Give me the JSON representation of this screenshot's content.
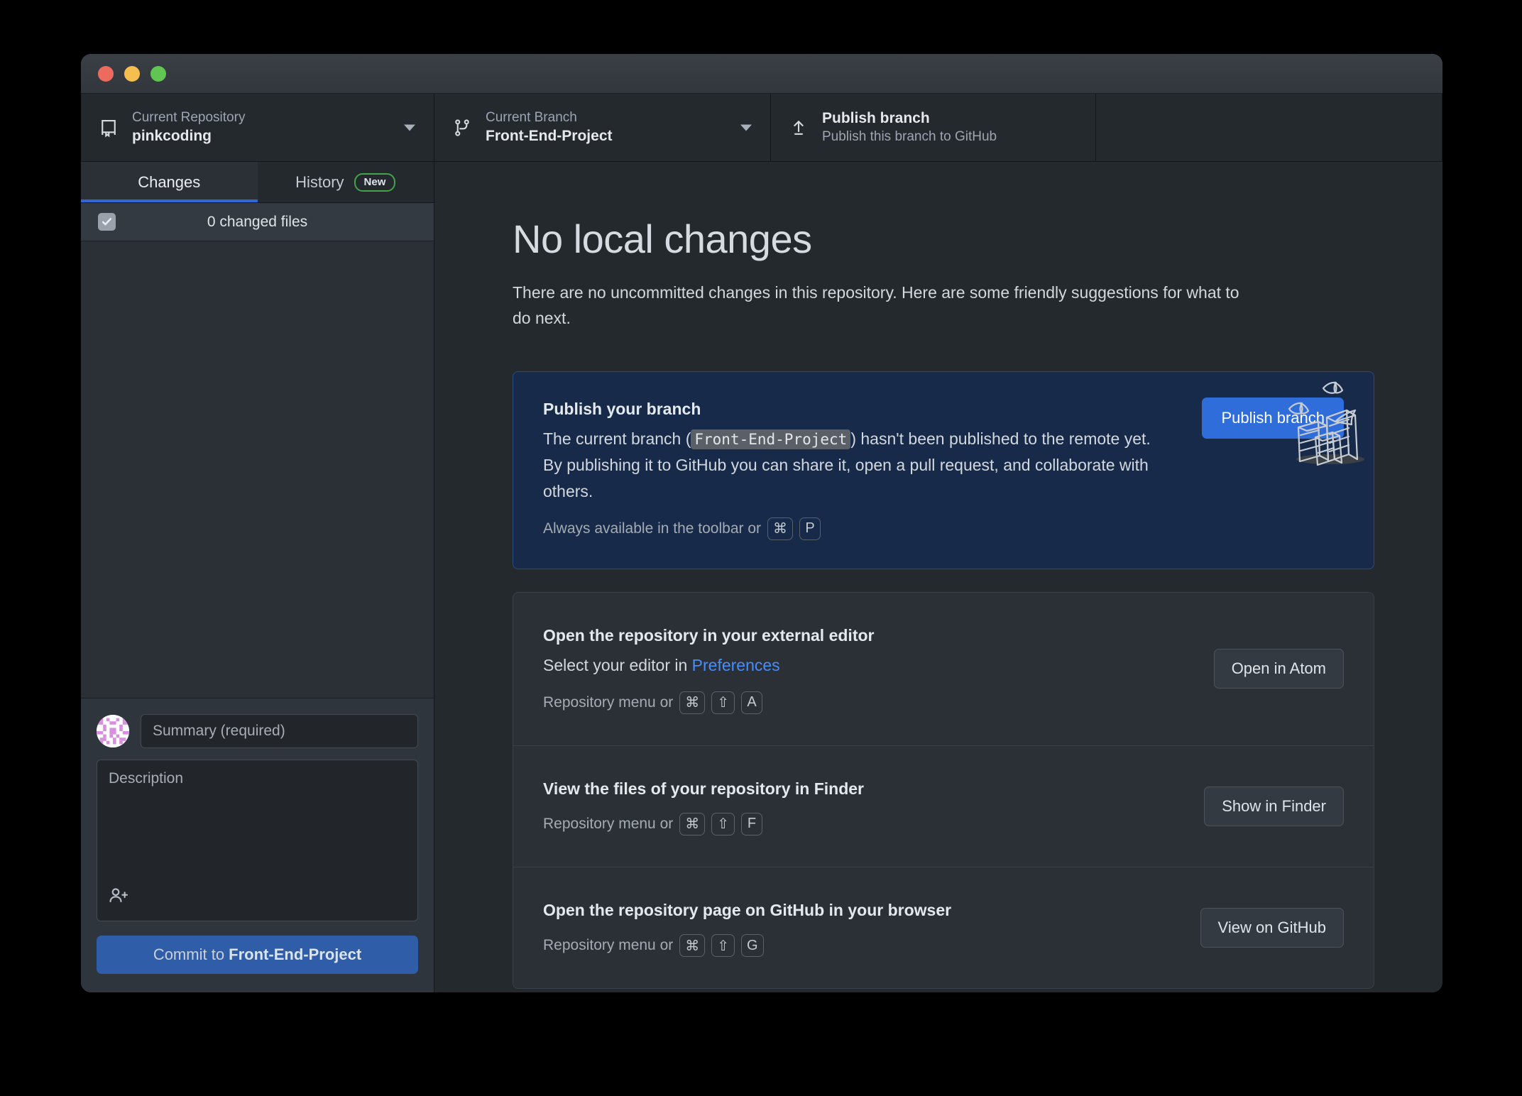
{
  "window": {
    "traffic_lights": [
      "close",
      "minimize",
      "maximize"
    ]
  },
  "toolbar": {
    "repository": {
      "label": "Current Repository",
      "value": "pinkcoding",
      "icon": "repo-icon"
    },
    "branch": {
      "label": "Current Branch",
      "value": "Front-End-Project",
      "icon": "git-branch-icon"
    },
    "publish": {
      "title": "Publish branch",
      "subtitle": "Publish this branch to GitHub",
      "icon": "upload-icon"
    }
  },
  "sidebar": {
    "tabs": [
      {
        "label": "Changes",
        "active": true
      },
      {
        "label": "History",
        "active": false,
        "badge": "New"
      }
    ],
    "changed_files_label": "0 changed files",
    "commit": {
      "summary_placeholder": "Summary (required)",
      "summary_value": "",
      "description_placeholder": "Description",
      "description_value": "",
      "coauthor_icon": "person-add-icon",
      "button_prefix": "Commit to ",
      "button_branch": "Front-End-Project"
    }
  },
  "main": {
    "title": "No local changes",
    "subtitle": "There are no uncommitted changes in this repository. Here are some friendly suggestions for what to do next.",
    "publish_card": {
      "title": "Publish your branch",
      "body_before": "The current branch (",
      "branch_chip": "Front-End-Project",
      "body_after": ") hasn't been published to the remote yet. By publishing it to GitHub you can share it, open a pull request, and collaborate with others.",
      "footer_text": "Always available in the toolbar or",
      "keys": [
        "⌘",
        "P"
      ],
      "button": "Publish branch"
    },
    "suggestions": [
      {
        "title": "Open the repository in your external editor",
        "body_before": "Select your editor in ",
        "body_link": "Preferences",
        "footer_text": "Repository menu or",
        "keys": [
          "⌘",
          "⇧",
          "A"
        ],
        "button": "Open in Atom"
      },
      {
        "title": "View the files of your repository in Finder",
        "body_before": "",
        "body_link": "",
        "footer_text": "Repository menu or",
        "keys": [
          "⌘",
          "⇧",
          "F"
        ],
        "button": "Show in Finder"
      },
      {
        "title": "Open the repository page on GitHub in your browser",
        "body_before": "",
        "body_link": "",
        "footer_text": "Repository menu or",
        "keys": [
          "⌘",
          "⇧",
          "G"
        ],
        "button": "View on GitHub"
      }
    ]
  },
  "colors": {
    "accent_blue": "#2f6ddb",
    "callout_bg": "#172a49",
    "badge_green": "#46a249",
    "link_blue": "#498ef5",
    "window_bg": "#24292e",
    "sidebar_bg": "#2b3036"
  }
}
